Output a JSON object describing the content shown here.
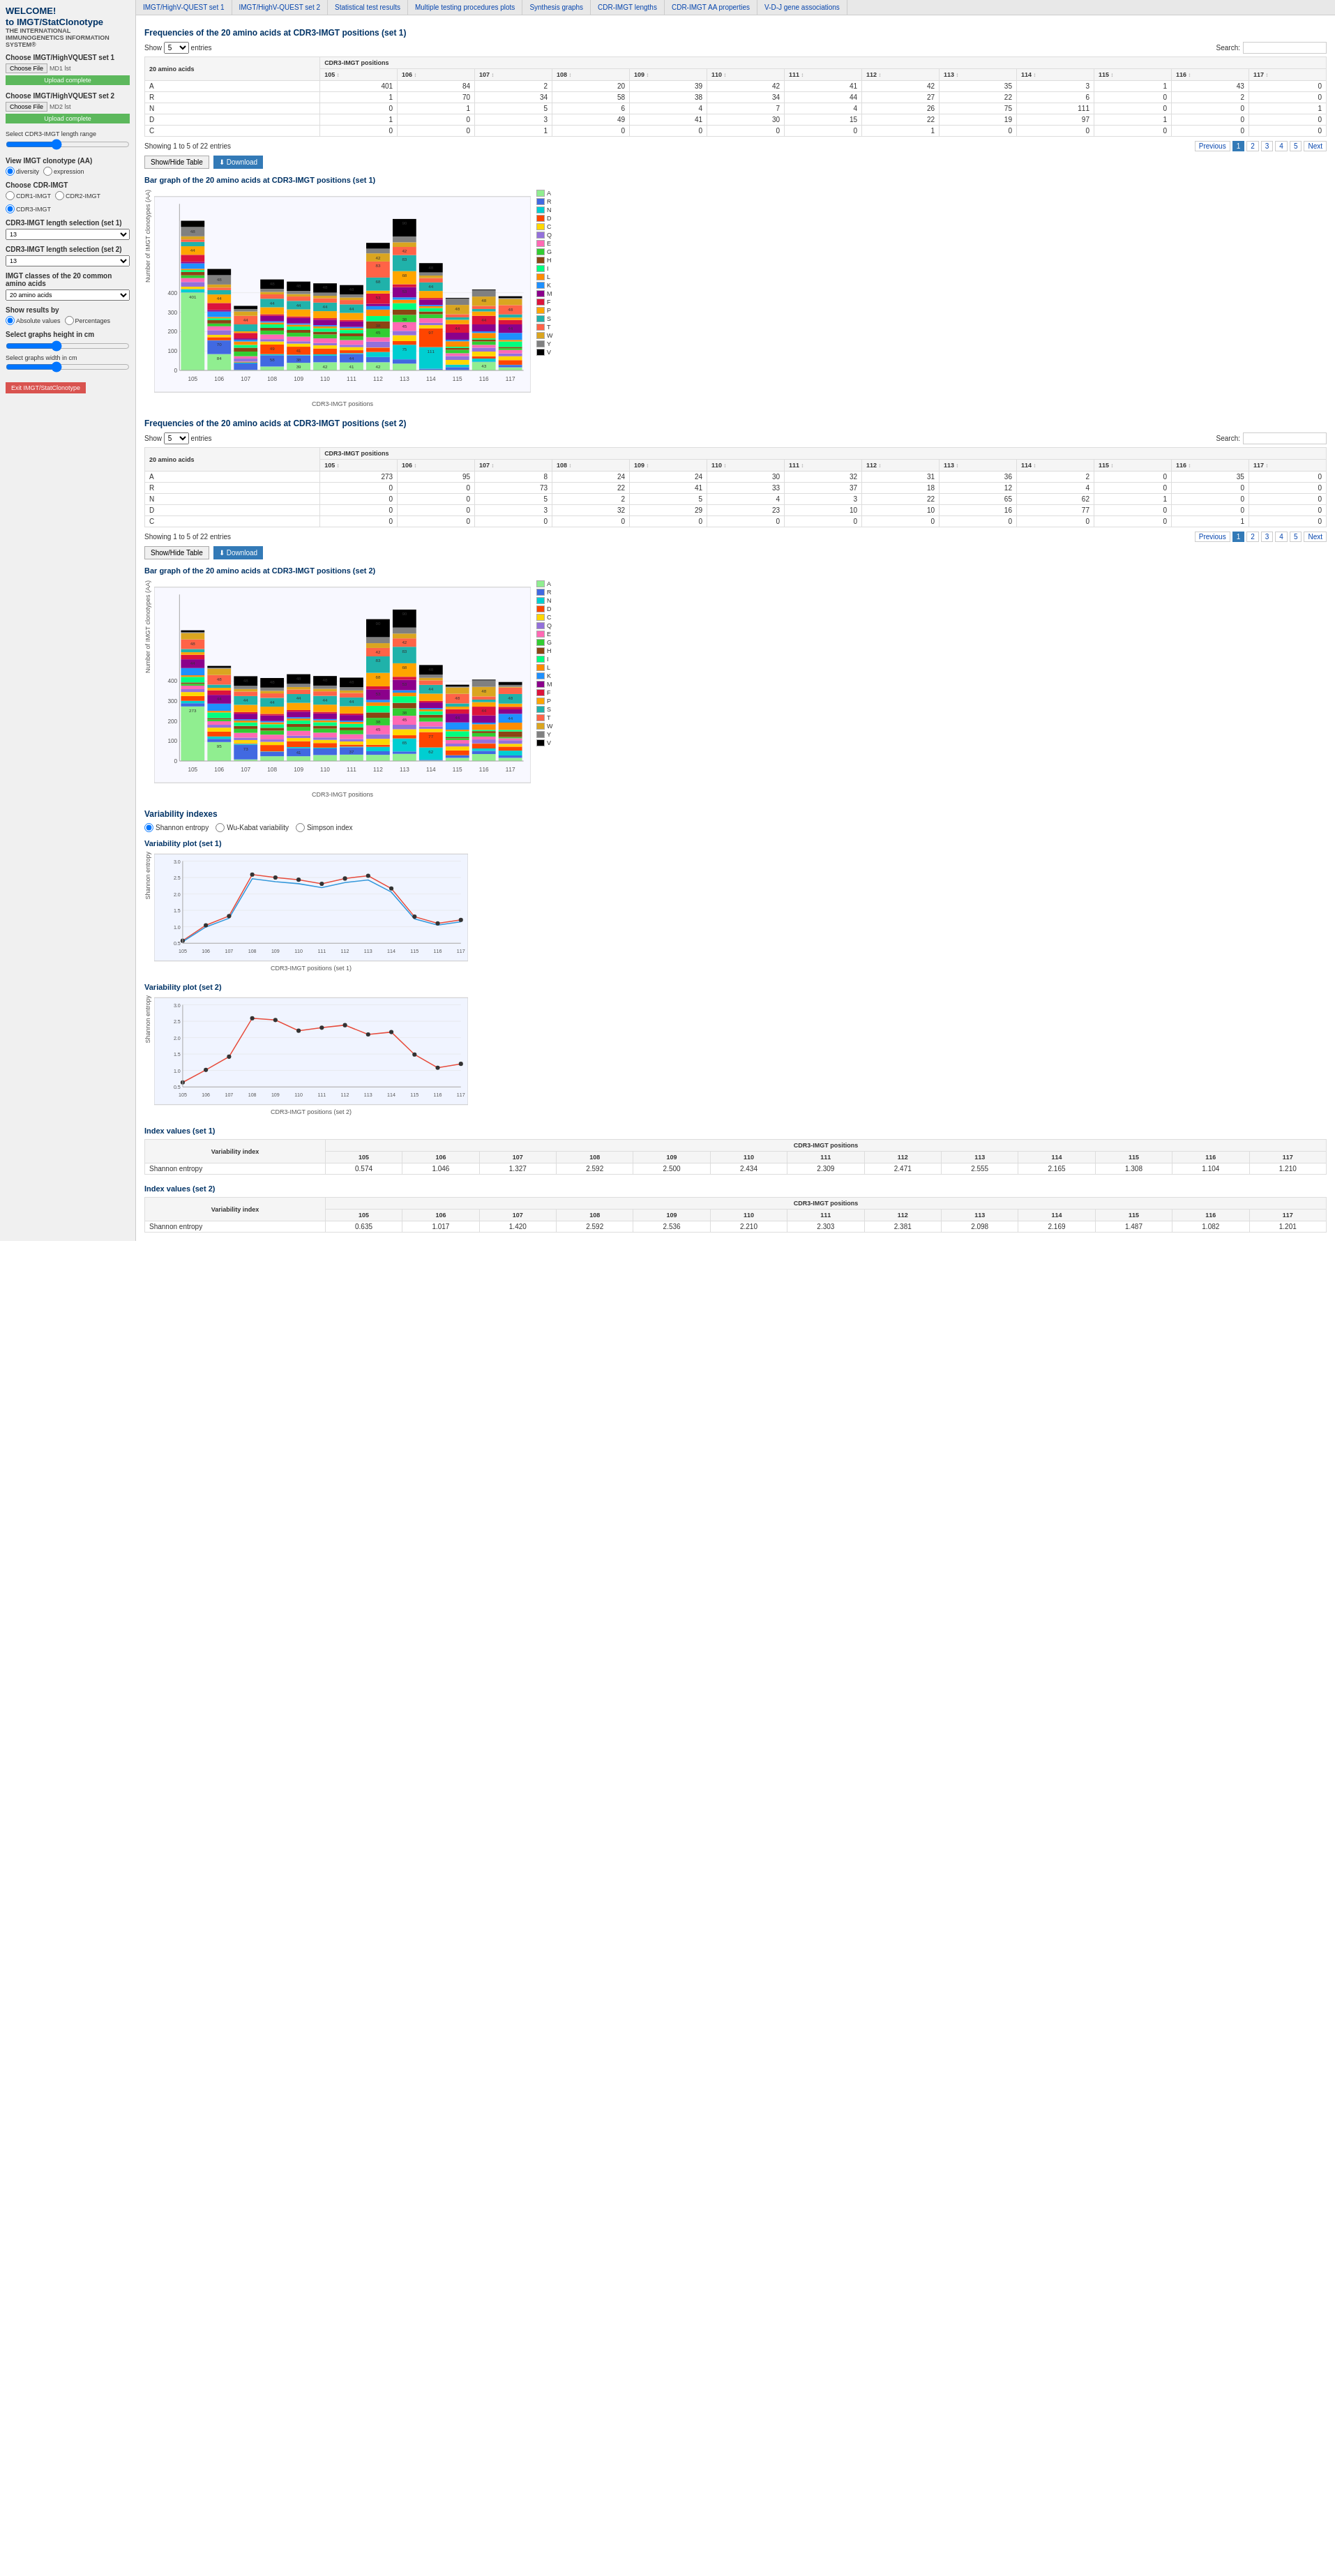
{
  "brand": {
    "welcome": "WELCOME!",
    "title": "to IMGT/StatClonotype",
    "subtitle": "THE INTERNATIONAL IMMUNOGENETICS INFORMATION SYSTEM®"
  },
  "nav": {
    "items": [
      {
        "id": "nav-highvquest1",
        "label": "IMGT/HighV-QUEST set 1"
      },
      {
        "id": "nav-highvquest2",
        "label": "IMGT/HighV-QUEST set 2"
      },
      {
        "id": "nav-statistical",
        "label": "Statistical test results"
      },
      {
        "id": "nav-multiple",
        "label": "Multiple testing procedures plots"
      },
      {
        "id": "nav-synthesis",
        "label": "Synthesis graphs"
      },
      {
        "id": "nav-cdr-imgt",
        "label": "CDR-IMGT lengths"
      },
      {
        "id": "nav-cdr-aa",
        "label": "CDR-IMGT AA properties"
      },
      {
        "id": "nav-vdj",
        "label": "V-D-J gene associations"
      }
    ]
  },
  "sidebar": {
    "set1_label": "Choose IMGT/HighVQUEST set 1",
    "set1_file_btn": "Choose File",
    "set1_file_name": "MD1 lst",
    "set1_upload_btn": "Upload complete",
    "set2_label": "Choose IMGT/HighVQUEST set 2",
    "set2_file_btn": "Choose File",
    "set2_file_name": "MD2 lst",
    "set2_upload_btn": "Upload complete",
    "range_label": "Select CDR3-IMGT length range",
    "range_min": "8",
    "range_max": "",
    "view_label": "View IMGT clonotype (AA)",
    "view_options": [
      "diversity",
      "expression"
    ],
    "view_selected": "diversity",
    "cdr_label": "Choose CDR-IMGT",
    "cdr_options": [
      "CDR1-IMGT",
      "CDR2-IMGT",
      "CDR3-IMGT"
    ],
    "cdr_selected": "CDR3-IMGT",
    "length_sel1_label": "CDR3-IMGT length selection (set 1)",
    "length_sel1_value": "13",
    "length_sel2_label": "CDR3-IMGT length selection (set 2)",
    "length_sel2_value": "13",
    "imgt_classes_label": "IMGT classes of the 20 common amino acids",
    "imgt_classes_value": "20 amino acids",
    "show_results_label": "Show results by",
    "show_results_options": [
      "Absolute values",
      "Percentages"
    ],
    "show_results_selected": "Absolute values",
    "graph_height_label": "Select graphs height in cm",
    "graph_height_min": "8",
    "graph_height_max": "",
    "graph_width_label": "Select graphs width in cm",
    "exit_btn": "Exit IMGT/StatClonotype"
  },
  "set1": {
    "freq_title": "Frequencies of the 20 amino acids at CDR3-IMGT positions (set 1)",
    "show_label": "Show",
    "entries_value": "5",
    "entries_label": "entries",
    "search_label": "Search:",
    "positions_header": "CDR3-IMGT positions",
    "aa_header": "20 amino acids",
    "columns": [
      "105",
      "106",
      "107",
      "108",
      "109",
      "110",
      "111",
      "112",
      "113",
      "114",
      "115",
      "116",
      "117"
    ],
    "rows": [
      {
        "aa": "A",
        "values": [
          "401",
          "84",
          "2",
          "20",
          "39",
          "42",
          "41",
          "42",
          "35",
          "3",
          "1",
          "43",
          "0"
        ]
      },
      {
        "aa": "R",
        "values": [
          "1",
          "70",
          "34",
          "58",
          "38",
          "34",
          "44",
          "27",
          "22",
          "6",
          "0",
          "2",
          "0"
        ]
      },
      {
        "aa": "N",
        "values": [
          "0",
          "1",
          "5",
          "6",
          "4",
          "7",
          "4",
          "26",
          "75",
          "111",
          "0",
          "0",
          "1"
        ]
      },
      {
        "aa": "D",
        "values": [
          "1",
          "0",
          "3",
          "49",
          "41",
          "30",
          "15",
          "22",
          "19",
          "97",
          "1",
          "0",
          "0"
        ]
      },
      {
        "aa": "C",
        "values": [
          "0",
          "0",
          "1",
          "0",
          "0",
          "0",
          "0",
          "1",
          "0",
          "0",
          "0",
          "0",
          "0"
        ]
      }
    ],
    "showing": "Showing 1 to 5 of 22 entries",
    "pagination": [
      "Previous",
      "1",
      "2",
      "3",
      "4",
      "5",
      "Next"
    ],
    "btn_show_hide": "Show/Hide Table",
    "btn_download": "Download",
    "bar_title": "Bar graph of the 20 amino acids at CDR3-IMGT positions (set 1)",
    "chart_x_label": "CDR3-IMGT positions",
    "chart_y_label": "Number of IMGT clonotypes (AA)",
    "chart_positions": [
      "105",
      "106",
      "107",
      "108",
      "109",
      "110",
      "111",
      "112",
      "113",
      "114",
      "115",
      "116",
      "117"
    ]
  },
  "set2": {
    "freq_title": "Frequencies of the 20 amino acids at CDR3-IMGT positions (set 2)",
    "show_label": "Show",
    "entries_value": "5",
    "entries_label": "entries",
    "search_label": "Search:",
    "positions_header": "CDR3-IMGT positions",
    "aa_header": "20 amino acids",
    "columns": [
      "105",
      "106",
      "107",
      "108",
      "109",
      "110",
      "111",
      "112",
      "113",
      "114",
      "115",
      "116",
      "117"
    ],
    "rows": [
      {
        "aa": "A",
        "values": [
          "273",
          "95",
          "8",
          "24",
          "24",
          "30",
          "32",
          "31",
          "36",
          "2",
          "0",
          "35",
          "0"
        ]
      },
      {
        "aa": "R",
        "values": [
          "0",
          "0",
          "73",
          "22",
          "41",
          "33",
          "37",
          "18",
          "12",
          "4",
          "0",
          "0",
          "0"
        ]
      },
      {
        "aa": "N",
        "values": [
          "0",
          "0",
          "5",
          "2",
          "5",
          "4",
          "3",
          "22",
          "65",
          "62",
          "1",
          "0",
          "0"
        ]
      },
      {
        "aa": "D",
        "values": [
          "0",
          "0",
          "3",
          "32",
          "29",
          "23",
          "10",
          "10",
          "16",
          "77",
          "0",
          "0",
          "0"
        ]
      },
      {
        "aa": "C",
        "values": [
          "0",
          "0",
          "0",
          "0",
          "0",
          "0",
          "0",
          "0",
          "0",
          "0",
          "0",
          "1",
          "0"
        ]
      }
    ],
    "showing": "Showing 1 to 5 of 22 entries",
    "pagination": [
      "Previous",
      "1",
      "2",
      "3",
      "4",
      "5",
      "Next"
    ],
    "btn_show_hide": "Show/Hide Table",
    "btn_download": "Download",
    "bar_title": "Bar graph of the 20 amino acids at CDR3-IMGT positions (set 2)",
    "chart_x_label": "CDR3-IMGT positions",
    "chart_y_label": "Number of IMGT clonotypes (AA)",
    "chart_positions": [
      "105",
      "106",
      "107",
      "108",
      "109",
      "110",
      "111",
      "112",
      "113",
      "114",
      "115",
      "116",
      "117"
    ]
  },
  "variability": {
    "title": "Variability indexes",
    "options": [
      "Shannon entropy",
      "Wu-Kabat variability",
      "Simpson index"
    ],
    "selected": "Shannon entropy",
    "plot1_title": "Variability plot (set 1)",
    "plot1_x_label": "CDR3-IMGT positions (set 1)",
    "plot1_y_label": "Shannon entropy",
    "plot1_positions": [
      "105",
      "106",
      "107",
      "108",
      "109",
      "110",
      "111",
      "112",
      "113",
      "114",
      "115",
      "116",
      "117"
    ],
    "plot1_values": [
      0.574,
      1.046,
      1.327,
      2.592,
      2.5,
      2.434,
      2.309,
      2.471,
      2.555,
      2.165,
      1.308,
      1.104,
      1.21
    ],
    "plot2_title": "Variability plot (set 2)",
    "plot2_x_label": "CDR3-IMGT positions (set 2)",
    "plot2_y_label": "Shannon entropy",
    "plot2_positions": [
      "105",
      "106",
      "107",
      "108",
      "109",
      "110",
      "111",
      "112",
      "113",
      "114",
      "115",
      "116",
      "117"
    ],
    "plot2_values": [
      0.635,
      1.017,
      1.42,
      2.592,
      2.536,
      2.21,
      2.303,
      2.381,
      2.098,
      2.169,
      1.487,
      1.082,
      1.201
    ],
    "index1_title": "Index values (set 1)",
    "index2_title": "Index values (set 2)",
    "index_col": "Variability index",
    "index_positions": [
      "105",
      "106",
      "107",
      "108",
      "109",
      "110",
      "111",
      "112",
      "113",
      "114",
      "115",
      "116",
      "117"
    ],
    "index1_rows": [
      {
        "label": "Shannon entropy",
        "values": [
          "0.574",
          "1.046",
          "1.327",
          "2.592",
          "2.500",
          "2.434",
          "2.309",
          "2.471",
          "2.555",
          "2.165",
          "1.308",
          "1.104",
          "1.210"
        ]
      }
    ],
    "index2_rows": [
      {
        "label": "Shannon entropy",
        "values": [
          "0.635",
          "1.017",
          "1.420",
          "2.592",
          "2.536",
          "2.210",
          "2.303",
          "2.381",
          "2.098",
          "2.169",
          "1.487",
          "1.082",
          "1.201"
        ]
      }
    ]
  },
  "legend": {
    "items": [
      "A",
      "R",
      "N",
      "D",
      "C",
      "Q",
      "E",
      "G",
      "H",
      "I",
      "L",
      "K",
      "M",
      "F",
      "P",
      "S",
      "T",
      "W",
      "Y",
      "V"
    ]
  },
  "bar_colors": {
    "A": "#90EE90",
    "R": "#4169E1",
    "N": "#00CED1",
    "D": "#FF4500",
    "C": "#FFD700",
    "Q": "#9370DB",
    "E": "#FF69B4",
    "G": "#32CD32",
    "H": "#8B4513",
    "I": "#00FF7F",
    "L": "#FF8C00",
    "K": "#1E90FF",
    "M": "#8B008B",
    "F": "#DC143C",
    "P": "#FFA500",
    "S": "#20B2AA",
    "T": "#FF6347",
    "W": "#DAA520",
    "Y": "#808080",
    "V": "#000000"
  }
}
